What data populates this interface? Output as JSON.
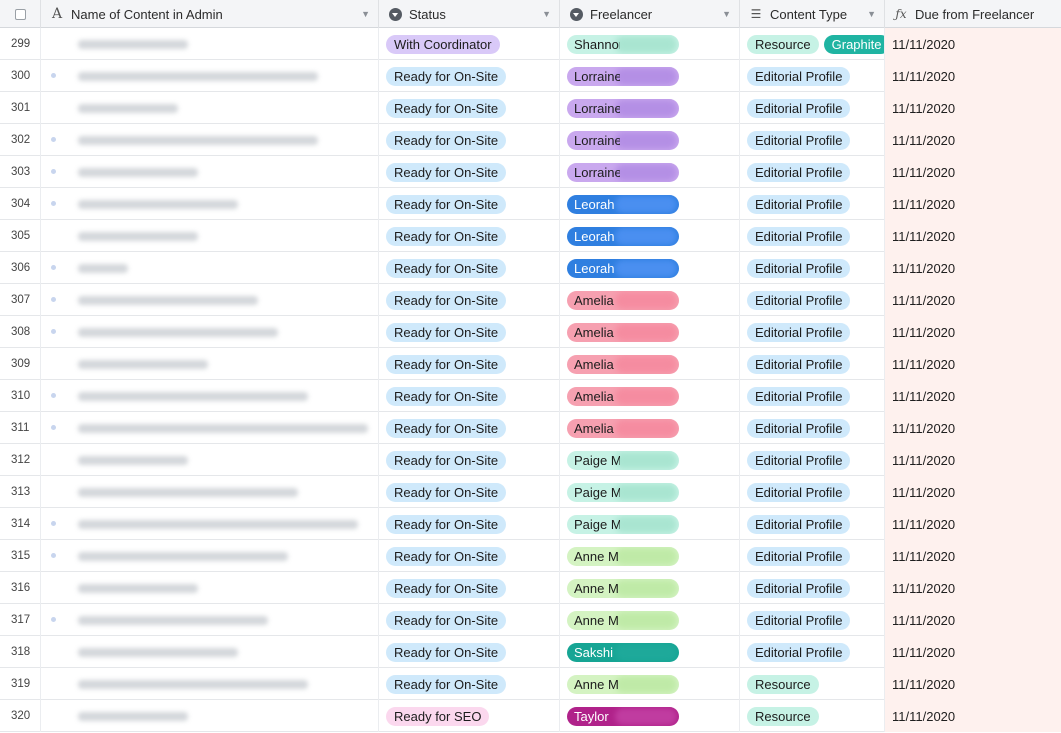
{
  "header": {
    "columns": [
      {
        "label": "Name of Content in Admin",
        "icon": "text-field-icon"
      },
      {
        "label": "Status",
        "icon": "single-select-icon"
      },
      {
        "label": "Freelancer",
        "icon": "single-select-icon"
      },
      {
        "label": "Content Type",
        "icon": "multiple-select-icon"
      },
      {
        "label": "Due from Freelancer",
        "icon": "formula-icon"
      }
    ]
  },
  "colors": {
    "with_coordinator": "#d9c9f8",
    "ready_on_site": "#cfe9fb",
    "ready_seo": "#fbd8ee",
    "resource": "#c6f2e5",
    "graphite": "#1fb4a2",
    "due_column_bg": "#fef1ee"
  },
  "rows": [
    {
      "num": "299",
      "status": "With Coordinator",
      "status_style": "coord",
      "freelancer": "Shannon",
      "free_style": "green",
      "types": [
        {
          "label": "Resource",
          "style": "resource"
        },
        {
          "label": "Graphite",
          "style": "graphite"
        }
      ],
      "due": "11/11/2020",
      "dot": false
    },
    {
      "num": "300",
      "status": "Ready for On-Site",
      "status_style": "onsite",
      "freelancer": "Lorraine",
      "free_style": "purple",
      "types": [
        {
          "label": "Editorial Profile",
          "style": "editorial"
        }
      ],
      "due": "11/11/2020",
      "dot": true
    },
    {
      "num": "301",
      "status": "Ready for On-Site",
      "status_style": "onsite",
      "freelancer": "Lorraine",
      "free_style": "purple",
      "types": [
        {
          "label": "Editorial Profile",
          "style": "editorial"
        }
      ],
      "due": "11/11/2020",
      "dot": false
    },
    {
      "num": "302",
      "status": "Ready for On-Site",
      "status_style": "onsite",
      "freelancer": "Lorraine",
      "free_style": "purple",
      "types": [
        {
          "label": "Editorial Profile",
          "style": "editorial"
        }
      ],
      "due": "11/11/2020",
      "dot": true
    },
    {
      "num": "303",
      "status": "Ready for On-Site",
      "status_style": "onsite",
      "freelancer": "Lorraine",
      "free_style": "purple",
      "types": [
        {
          "label": "Editorial Profile",
          "style": "editorial"
        }
      ],
      "due": "11/11/2020",
      "dot": true
    },
    {
      "num": "304",
      "status": "Ready for On-Site",
      "status_style": "onsite",
      "freelancer": "Leorah",
      "free_style": "blue",
      "types": [
        {
          "label": "Editorial Profile",
          "style": "editorial"
        }
      ],
      "due": "11/11/2020",
      "dot": true
    },
    {
      "num": "305",
      "status": "Ready for On-Site",
      "status_style": "onsite",
      "freelancer": "Leorah",
      "free_style": "blue",
      "types": [
        {
          "label": "Editorial Profile",
          "style": "editorial"
        }
      ],
      "due": "11/11/2020",
      "dot": false
    },
    {
      "num": "306",
      "status": "Ready for On-Site",
      "status_style": "onsite",
      "freelancer": "Leorah",
      "free_style": "blue",
      "types": [
        {
          "label": "Editorial Profile",
          "style": "editorial"
        }
      ],
      "due": "11/11/2020",
      "dot": true
    },
    {
      "num": "307",
      "status": "Ready for On-Site",
      "status_style": "onsite",
      "freelancer": "Amelia",
      "free_style": "red",
      "types": [
        {
          "label": "Editorial Profile",
          "style": "editorial"
        }
      ],
      "due": "11/11/2020",
      "dot": true
    },
    {
      "num": "308",
      "status": "Ready for On-Site",
      "status_style": "onsite",
      "freelancer": "Amelia",
      "free_style": "red",
      "types": [
        {
          "label": "Editorial Profile",
          "style": "editorial"
        }
      ],
      "due": "11/11/2020",
      "dot": true
    },
    {
      "num": "309",
      "status": "Ready for On-Site",
      "status_style": "onsite",
      "freelancer": "Amelia",
      "free_style": "red",
      "types": [
        {
          "label": "Editorial Profile",
          "style": "editorial"
        }
      ],
      "due": "11/11/2020",
      "dot": false
    },
    {
      "num": "310",
      "status": "Ready for On-Site",
      "status_style": "onsite",
      "freelancer": "Amelia",
      "free_style": "red",
      "types": [
        {
          "label": "Editorial Profile",
          "style": "editorial"
        }
      ],
      "due": "11/11/2020",
      "dot": true
    },
    {
      "num": "311",
      "status": "Ready for On-Site",
      "status_style": "onsite",
      "freelancer": "Amelia",
      "free_style": "red",
      "types": [
        {
          "label": "Editorial Profile",
          "style": "editorial"
        }
      ],
      "due": "11/11/2020",
      "dot": true
    },
    {
      "num": "312",
      "status": "Ready for On-Site",
      "status_style": "onsite",
      "freelancer": "Paige M",
      "free_style": "green",
      "types": [
        {
          "label": "Editorial Profile",
          "style": "editorial"
        }
      ],
      "due": "11/11/2020",
      "dot": false
    },
    {
      "num": "313",
      "status": "Ready for On-Site",
      "status_style": "onsite",
      "freelancer": "Paige M",
      "free_style": "green",
      "types": [
        {
          "label": "Editorial Profile",
          "style": "editorial"
        }
      ],
      "due": "11/11/2020",
      "dot": false
    },
    {
      "num": "314",
      "status": "Ready for On-Site",
      "status_style": "onsite",
      "freelancer": "Paige M",
      "free_style": "green",
      "types": [
        {
          "label": "Editorial Profile",
          "style": "editorial"
        }
      ],
      "due": "11/11/2020",
      "dot": true
    },
    {
      "num": "315",
      "status": "Ready for On-Site",
      "status_style": "onsite",
      "freelancer": "Anne M",
      "free_style": "lime",
      "types": [
        {
          "label": "Editorial Profile",
          "style": "editorial"
        }
      ],
      "due": "11/11/2020",
      "dot": true
    },
    {
      "num": "316",
      "status": "Ready for On-Site",
      "status_style": "onsite",
      "freelancer": "Anne M",
      "free_style": "lime",
      "types": [
        {
          "label": "Editorial Profile",
          "style": "editorial"
        }
      ],
      "due": "11/11/2020",
      "dot": false
    },
    {
      "num": "317",
      "status": "Ready for On-Site",
      "status_style": "onsite",
      "freelancer": "Anne M",
      "free_style": "lime",
      "types": [
        {
          "label": "Editorial Profile",
          "style": "editorial"
        }
      ],
      "due": "11/11/2020",
      "dot": true
    },
    {
      "num": "318",
      "status": "Ready for On-Site",
      "status_style": "onsite",
      "freelancer": "Sakshi",
      "free_style": "teal",
      "types": [
        {
          "label": "Editorial Profile",
          "style": "editorial"
        }
      ],
      "due": "11/11/2020",
      "dot": false
    },
    {
      "num": "319",
      "status": "Ready for On-Site",
      "status_style": "onsite",
      "freelancer": "Anne M",
      "free_style": "lime",
      "types": [
        {
          "label": "Resource",
          "style": "resource"
        }
      ],
      "due": "11/11/2020",
      "dot": false
    },
    {
      "num": "320",
      "status": "Ready for SEO",
      "status_style": "seo",
      "freelancer": "Taylor",
      "free_style": "magenta",
      "types": [
        {
          "label": "Resource",
          "style": "resource"
        }
      ],
      "due": "11/11/2020",
      "dot": false
    }
  ]
}
